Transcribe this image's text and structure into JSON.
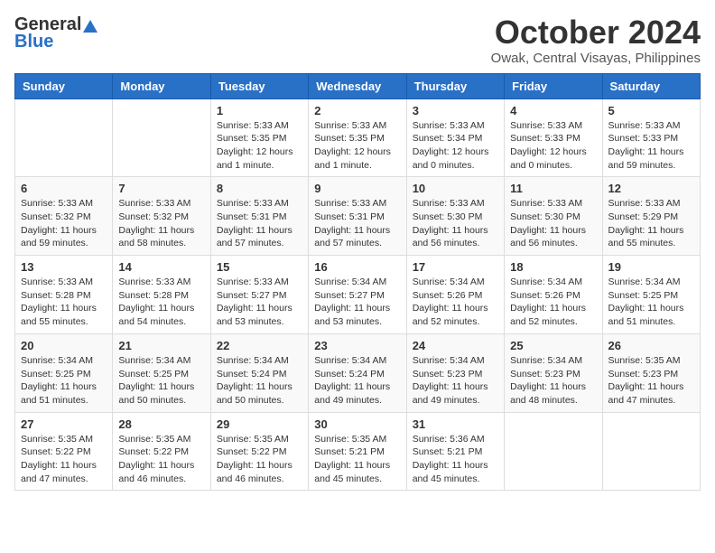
{
  "header": {
    "logo_general": "General",
    "logo_blue": "Blue",
    "month": "October 2024",
    "location": "Owak, Central Visayas, Philippines"
  },
  "weekdays": [
    "Sunday",
    "Monday",
    "Tuesday",
    "Wednesday",
    "Thursday",
    "Friday",
    "Saturday"
  ],
  "weeks": [
    [
      {
        "day": "",
        "detail": ""
      },
      {
        "day": "",
        "detail": ""
      },
      {
        "day": "1",
        "detail": "Sunrise: 5:33 AM\nSunset: 5:35 PM\nDaylight: 12 hours\nand 1 minute."
      },
      {
        "day": "2",
        "detail": "Sunrise: 5:33 AM\nSunset: 5:35 PM\nDaylight: 12 hours\nand 1 minute."
      },
      {
        "day": "3",
        "detail": "Sunrise: 5:33 AM\nSunset: 5:34 PM\nDaylight: 12 hours\nand 0 minutes."
      },
      {
        "day": "4",
        "detail": "Sunrise: 5:33 AM\nSunset: 5:33 PM\nDaylight: 12 hours\nand 0 minutes."
      },
      {
        "day": "5",
        "detail": "Sunrise: 5:33 AM\nSunset: 5:33 PM\nDaylight: 11 hours\nand 59 minutes."
      }
    ],
    [
      {
        "day": "6",
        "detail": "Sunrise: 5:33 AM\nSunset: 5:32 PM\nDaylight: 11 hours\nand 59 minutes."
      },
      {
        "day": "7",
        "detail": "Sunrise: 5:33 AM\nSunset: 5:32 PM\nDaylight: 11 hours\nand 58 minutes."
      },
      {
        "day": "8",
        "detail": "Sunrise: 5:33 AM\nSunset: 5:31 PM\nDaylight: 11 hours\nand 57 minutes."
      },
      {
        "day": "9",
        "detail": "Sunrise: 5:33 AM\nSunset: 5:31 PM\nDaylight: 11 hours\nand 57 minutes."
      },
      {
        "day": "10",
        "detail": "Sunrise: 5:33 AM\nSunset: 5:30 PM\nDaylight: 11 hours\nand 56 minutes."
      },
      {
        "day": "11",
        "detail": "Sunrise: 5:33 AM\nSunset: 5:30 PM\nDaylight: 11 hours\nand 56 minutes."
      },
      {
        "day": "12",
        "detail": "Sunrise: 5:33 AM\nSunset: 5:29 PM\nDaylight: 11 hours\nand 55 minutes."
      }
    ],
    [
      {
        "day": "13",
        "detail": "Sunrise: 5:33 AM\nSunset: 5:28 PM\nDaylight: 11 hours\nand 55 minutes."
      },
      {
        "day": "14",
        "detail": "Sunrise: 5:33 AM\nSunset: 5:28 PM\nDaylight: 11 hours\nand 54 minutes."
      },
      {
        "day": "15",
        "detail": "Sunrise: 5:33 AM\nSunset: 5:27 PM\nDaylight: 11 hours\nand 53 minutes."
      },
      {
        "day": "16",
        "detail": "Sunrise: 5:34 AM\nSunset: 5:27 PM\nDaylight: 11 hours\nand 53 minutes."
      },
      {
        "day": "17",
        "detail": "Sunrise: 5:34 AM\nSunset: 5:26 PM\nDaylight: 11 hours\nand 52 minutes."
      },
      {
        "day": "18",
        "detail": "Sunrise: 5:34 AM\nSunset: 5:26 PM\nDaylight: 11 hours\nand 52 minutes."
      },
      {
        "day": "19",
        "detail": "Sunrise: 5:34 AM\nSunset: 5:25 PM\nDaylight: 11 hours\nand 51 minutes."
      }
    ],
    [
      {
        "day": "20",
        "detail": "Sunrise: 5:34 AM\nSunset: 5:25 PM\nDaylight: 11 hours\nand 51 minutes."
      },
      {
        "day": "21",
        "detail": "Sunrise: 5:34 AM\nSunset: 5:25 PM\nDaylight: 11 hours\nand 50 minutes."
      },
      {
        "day": "22",
        "detail": "Sunrise: 5:34 AM\nSunset: 5:24 PM\nDaylight: 11 hours\nand 50 minutes."
      },
      {
        "day": "23",
        "detail": "Sunrise: 5:34 AM\nSunset: 5:24 PM\nDaylight: 11 hours\nand 49 minutes."
      },
      {
        "day": "24",
        "detail": "Sunrise: 5:34 AM\nSunset: 5:23 PM\nDaylight: 11 hours\nand 49 minutes."
      },
      {
        "day": "25",
        "detail": "Sunrise: 5:34 AM\nSunset: 5:23 PM\nDaylight: 11 hours\nand 48 minutes."
      },
      {
        "day": "26",
        "detail": "Sunrise: 5:35 AM\nSunset: 5:23 PM\nDaylight: 11 hours\nand 47 minutes."
      }
    ],
    [
      {
        "day": "27",
        "detail": "Sunrise: 5:35 AM\nSunset: 5:22 PM\nDaylight: 11 hours\nand 47 minutes."
      },
      {
        "day": "28",
        "detail": "Sunrise: 5:35 AM\nSunset: 5:22 PM\nDaylight: 11 hours\nand 46 minutes."
      },
      {
        "day": "29",
        "detail": "Sunrise: 5:35 AM\nSunset: 5:22 PM\nDaylight: 11 hours\nand 46 minutes."
      },
      {
        "day": "30",
        "detail": "Sunrise: 5:35 AM\nSunset: 5:21 PM\nDaylight: 11 hours\nand 45 minutes."
      },
      {
        "day": "31",
        "detail": "Sunrise: 5:36 AM\nSunset: 5:21 PM\nDaylight: 11 hours\nand 45 minutes."
      },
      {
        "day": "",
        "detail": ""
      },
      {
        "day": "",
        "detail": ""
      }
    ]
  ]
}
